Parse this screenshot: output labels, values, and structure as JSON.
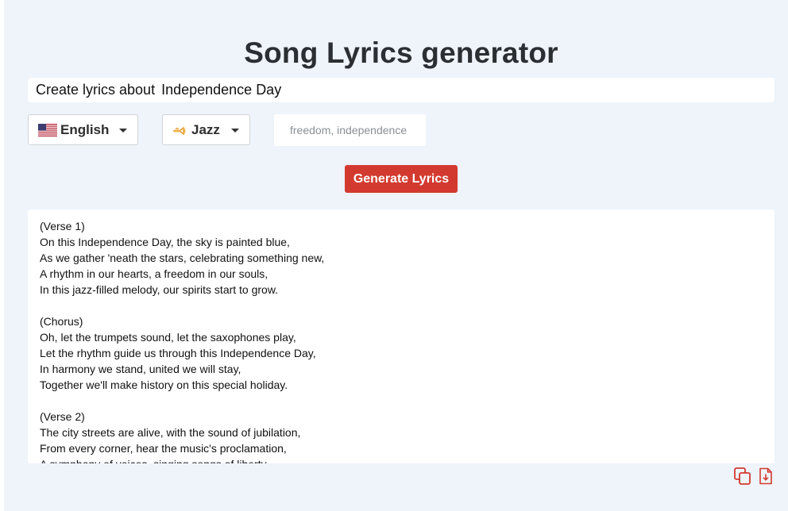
{
  "page": {
    "title": "Song Lyrics generator"
  },
  "topic": {
    "prefix": "Create lyrics about",
    "value": "Independence Day"
  },
  "language_select": {
    "selected": "English",
    "icon": "us-flag-icon"
  },
  "style_select": {
    "selected": "Jazz",
    "icon": "trumpet-icon"
  },
  "keywords_input": {
    "value": "",
    "placeholder": "freedom, independence"
  },
  "generate_button": {
    "label": "Generate Lyrics"
  },
  "lyrics": {
    "text": "(Verse 1)\nOn this Independence Day, the sky is painted blue,\nAs we gather 'neath the stars, celebrating something new,\nA rhythm in our hearts, a freedom in our souls,\nIn this jazz-filled melody, our spirits start to grow.\n\n(Chorus)\nOh, let the trumpets sound, let the saxophones play,\nLet the rhythm guide us through this Independence Day,\nIn harmony we stand, united we will stay,\nTogether we'll make history on this special holiday.\n\n(Verse 2)\nThe city streets are alive, with the sound of jubilation,\nFrom every corner, hear the music's proclamation,\nA symphony of voices, singing songs of liberty,"
  },
  "actions": {
    "copy_icon": "copy-icon",
    "download_icon": "download-file-icon"
  },
  "colors": {
    "background": "#eef4fa",
    "accent": "#d33a2f",
    "title": "#2b2f33"
  }
}
